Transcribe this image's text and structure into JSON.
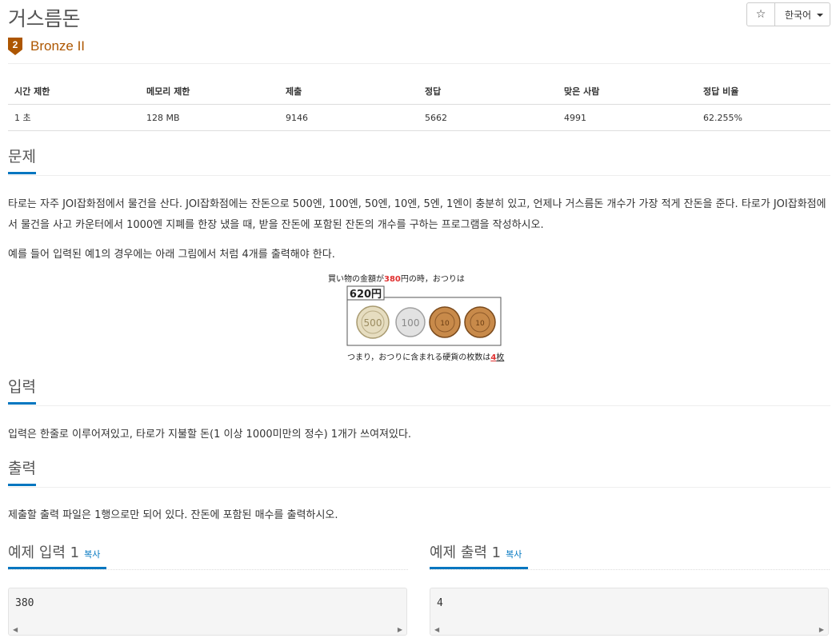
{
  "problem": {
    "title": "거스름돈",
    "tier": "Bronze II",
    "tier_number": "2",
    "tier_color": "#ad5600"
  },
  "header": {
    "star_icon": "star-icon",
    "star_glyph": "☆",
    "language": "한국어"
  },
  "info": {
    "headers": [
      "시간 제한",
      "메모리 제한",
      "제출",
      "정답",
      "맞은 사람",
      "정답 비율"
    ],
    "values": [
      "1 초",
      "128 MB",
      "9146",
      "5662",
      "4991",
      "62.255%"
    ]
  },
  "sections": {
    "problem": {
      "heading": "문제",
      "para1": "타로는 자주 JOI잡화점에서 물건을 산다. JOI잡화점에는 잔돈으로 500엔, 100엔, 50엔, 10엔, 5엔, 1엔이 충분히 있고, 언제나 거스름돈 개수가 가장 적게 잔돈을 준다. 타로가 JOI잡화점에서 물건을 사고 카운터에서 1000엔 지폐를 한장 냈을 때, 받을 잔돈에 포함된 잔돈의 개수를 구하는 프로그램을 작성하시오.",
      "para2": "예를 들어 입력된 예1의 경우에는 아래 그림에서 처럼 4개를 출력해야 한다."
    },
    "input": {
      "heading": "입력",
      "text": "입력은 한줄로 이루어져있고, 타로가 지불할 돈(1 이상 1000미만의 정수) 1개가 쓰여져있다."
    },
    "output": {
      "heading": "출력",
      "text": "제출할 출력 파일은 1행으로만 되어 있다. 잔돈에 포함된 매수를 출력하시오."
    }
  },
  "figure": {
    "top_prefix": "買い物の金額が",
    "top_amount": "380",
    "top_suffix": "円の時，おつりは",
    "change_label": "620円",
    "coins": [
      "500",
      "100",
      "10",
      "10"
    ],
    "bottom_prefix": "つまり，おつりに含まれる硬貨の枚数は",
    "bottom_count": "4",
    "bottom_suffix": "枚"
  },
  "samples": {
    "input": {
      "heading": "예제 입력 1",
      "copy": "복사",
      "value": "380"
    },
    "output": {
      "heading": "예제 출력 1",
      "copy": "복사",
      "value": "4"
    }
  }
}
